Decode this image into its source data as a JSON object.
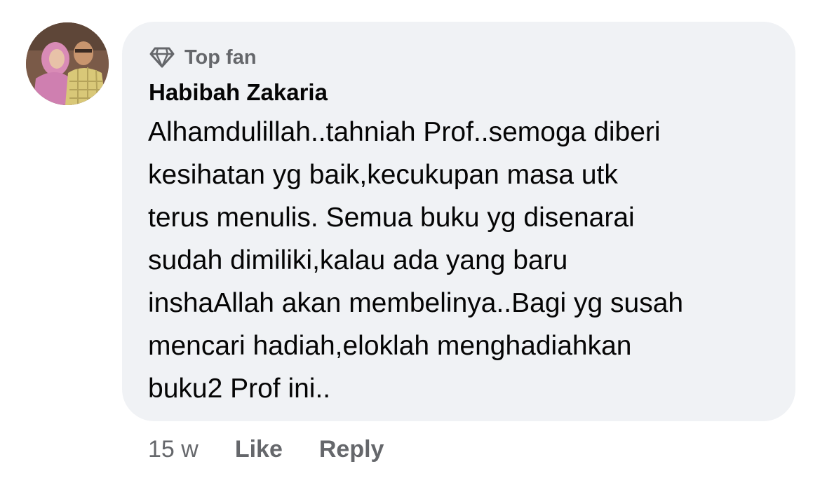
{
  "comment": {
    "badge_label": "Top fan",
    "badge_icon": "diamond-icon",
    "author": "Habibah Zakaria",
    "lines": [
      "Alhamdulillah..tahniah Prof..semoga diberi",
      "kesihatan yg baik,kecukupan masa utk",
      "terus menulis. Semua buku yg disenarai",
      "sudah dimiliki,kalau ada yang baru",
      "inshaAllah akan membelinya..Bagi yg susah",
      "mencari hadiah,eloklah menghadiahkan",
      "buku2 Prof ini.."
    ],
    "timestamp": "15 w",
    "like_label": "Like",
    "reply_label": "Reply"
  },
  "colors": {
    "bubble_bg": "#f0f2f5",
    "text_primary": "#050505",
    "text_secondary": "#65676b"
  }
}
